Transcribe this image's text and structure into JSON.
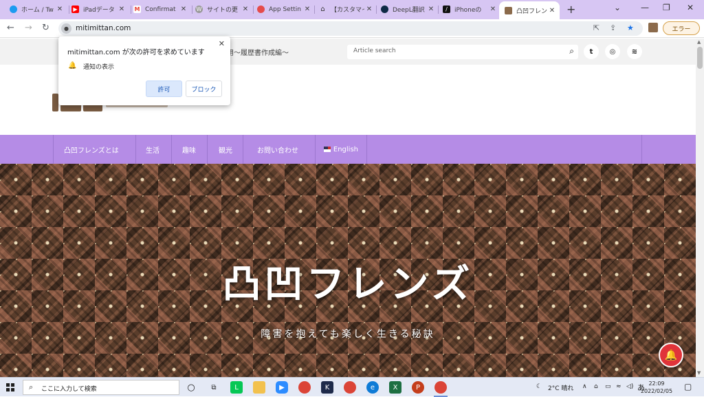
{
  "browser": {
    "tabs": [
      {
        "title": "ホーム / Tw",
        "fav_color": "#1d9bf0"
      },
      {
        "title": "iPadデータ",
        "fav_color": "#ff0000"
      },
      {
        "title": "Confirmat",
        "fav_color": "#ea4335"
      },
      {
        "title": "サイトの更",
        "fav_color": "#7a7a7a"
      },
      {
        "title": "App Settin",
        "fav_color": "#e54b4b"
      },
      {
        "title": "【カスタマイ",
        "fav_color": "#555555"
      },
      {
        "title": "DeepL翻訳",
        "fav_color": "#0f2b46"
      },
      {
        "title": "iPhoneの",
        "fav_color": "#111111"
      },
      {
        "title": "凸凹フレンズ",
        "fav_color": "#8b6a4b",
        "active": true
      }
    ],
    "new_tab": "+",
    "url": "mitimittan.com",
    "profile_label": "エラー",
    "window_controls": {
      "minimize": "—",
      "restore": "❐",
      "close": "✕"
    }
  },
  "site": {
    "tagline": "用～履歴書作成編～",
    "search_placeholder": "Article search",
    "menu": [
      "凸凹フレンズとは",
      "生活",
      "趣味",
      "観光",
      "お問い合わせ",
      "English"
    ],
    "hero_title": "凸凹フレンズ",
    "hero_subtitle": "障害を抱えても楽しく生きる秘訣"
  },
  "permission_popup": {
    "message": "mitimittan.com が次の許可を求めています",
    "permission": "通知の表示",
    "allow": "許可",
    "block": "ブロック"
  },
  "taskbar": {
    "search_placeholder": "ここに入力して検索",
    "weather": "2°C 晴れ",
    "ime": "あ",
    "time": "22:09",
    "date": "2022/02/05"
  }
}
